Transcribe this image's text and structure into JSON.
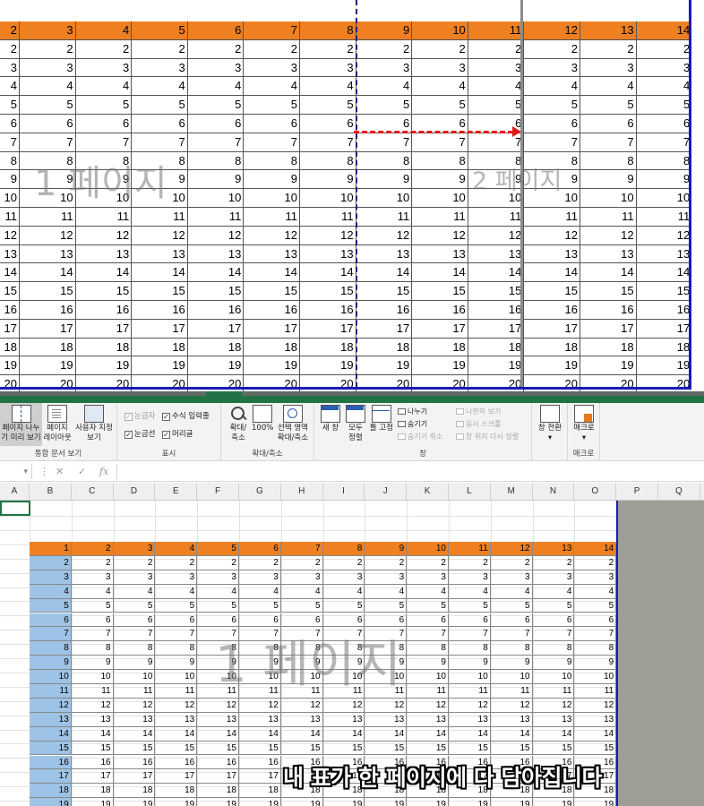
{
  "top_view": {
    "header_row": [
      "2",
      "3",
      "4",
      "5",
      "6",
      "7",
      "8",
      "9",
      "10",
      "11",
      "12",
      "13",
      "14"
    ],
    "row_values": [
      "2",
      "3",
      "4",
      "5",
      "6",
      "7",
      "8",
      "9",
      "10",
      "11",
      "12",
      "13",
      "14",
      "15",
      "16",
      "17",
      "18",
      "19",
      "20"
    ],
    "watermark_page1": "1 페이지",
    "watermark_page2": "2 페이지"
  },
  "ribbon": {
    "groups": [
      {
        "label": "통합 문서 보기",
        "buttons": [
          "페이지 나누기 미리 보기",
          "페이지 레이아웃",
          "사용자 지정 보기"
        ]
      },
      {
        "label": "표시",
        "checkboxes": [
          {
            "label": "눈금자",
            "checked": true,
            "disabled": true
          },
          {
            "label": "수식 입력줄",
            "checked": true,
            "disabled": false
          },
          {
            "label": "눈금선",
            "checked": true,
            "disabled": false
          },
          {
            "label": "머리글",
            "checked": true,
            "disabled": false
          }
        ]
      },
      {
        "label": "확대/축소",
        "buttons": [
          "확대/축소",
          "100%",
          "선택 영역 확대/축소"
        ]
      },
      {
        "label": "창",
        "buttons": [
          "새 창",
          "모두 정렬",
          "틀 고정"
        ],
        "items": [
          {
            "label": "나누기",
            "disabled": false
          },
          {
            "label": "숨기기",
            "disabled": false
          },
          {
            "label": "숨기기 취소",
            "disabled": true
          },
          {
            "label": "나란히 보기",
            "disabled": true
          },
          {
            "label": "동시 스크롤",
            "disabled": true
          },
          {
            "label": "창 위치 다시 정렬",
            "disabled": true
          }
        ],
        "switch_button": "창 전환"
      },
      {
        "label": "매크로",
        "buttons": [
          "매크로"
        ]
      }
    ],
    "page_break_label_1": "페이지 나누",
    "page_break_label_2": "기 미리 보기",
    "page_layout_label_1": "페이지",
    "page_layout_label_2": "레이아웃",
    "custom_view_label_1": "사용자 지정",
    "custom_view_label_2": "보기",
    "zoom_label_1": "확대/",
    "zoom_label_2": "축소",
    "zoom100_label": "100%",
    "zoomsel_label_1": "선택 영역",
    "zoomsel_label_2": "확대/축소",
    "newwin_label": "새 창",
    "arrange_label_1": "모두",
    "arrange_label_2": "정렬",
    "freeze_label": "틀 고정",
    "switch_label": "창 전환",
    "macro_label": "매크로"
  },
  "formula_bar": {
    "cancel_symbol": "✕",
    "enter_symbol": "✓",
    "fx_symbol": "fx",
    "value": ""
  },
  "columns": [
    "A",
    "B",
    "C",
    "D",
    "E",
    "F",
    "G",
    "H",
    "I",
    "J",
    "K",
    "L",
    "M",
    "N",
    "O",
    "P",
    "Q"
  ],
  "bottom_view": {
    "header_row": [
      "1",
      "2",
      "3",
      "4",
      "5",
      "6",
      "7",
      "8",
      "9",
      "10",
      "11",
      "12",
      "13",
      "14"
    ],
    "row_values": [
      "2",
      "3",
      "4",
      "5",
      "6",
      "7",
      "8",
      "9",
      "10",
      "11",
      "12",
      "13",
      "14",
      "15",
      "16",
      "17",
      "18",
      "19"
    ],
    "watermark": "1 페이지",
    "caption": "내 표가 한 페이지에 다 담아집니다"
  },
  "colors": {
    "header_orange": "#ee8022",
    "first_col_blue": "#9dc3e6",
    "page_frame_blue": "#1a1ab8",
    "arrow_red": "#e01b1b",
    "excel_green": "#217346"
  }
}
